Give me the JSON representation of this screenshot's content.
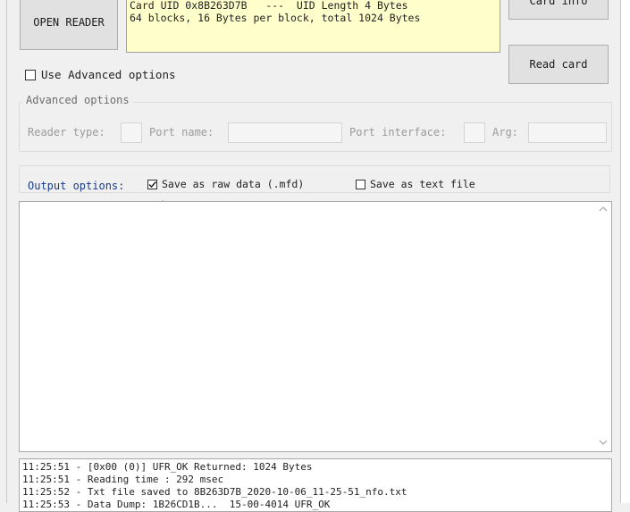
{
  "buttons": {
    "open_reader": "OPEN READER",
    "card_info": "Card info",
    "read_card": "Read card"
  },
  "card_info": {
    "line1": "Card UID 0x8B263D7B   ---  UID Length 4 Bytes",
    "line2": "64 blocks, 16 Bytes per block, total 1024 Bytes"
  },
  "advanced": {
    "use_label": "Use Advanced options",
    "checked": false,
    "group_title": "Advanced options",
    "reader_type_label": "Reader type:",
    "port_name_label": "Port name:",
    "port_interface_label": "Port interface:",
    "arg_label": "Arg:"
  },
  "output_options": {
    "label": "Output options:",
    "raw": {
      "label": "Save as raw data (.mfd)",
      "checked": true
    },
    "text": {
      "label": "Save as text file",
      "checked": false
    }
  },
  "log": {
    "lines": [
      "11:25:51 - [0x00 (0)] UFR_OK Returned: 1024 Bytes",
      "11:25:51 - Reading time : 292 msec",
      "11:25:52 - Txt file saved to 8B263D7B_2020-10-06_11-25-51_nfo.txt",
      "11:25:53 - Data Dump: 1B26CD1B...  15-00-4014 UFR_OK"
    ]
  },
  "colors": {
    "info_bg": "#ffffcc",
    "accent_label": "#1a3c8c",
    "pointer": "#c81e1e"
  }
}
